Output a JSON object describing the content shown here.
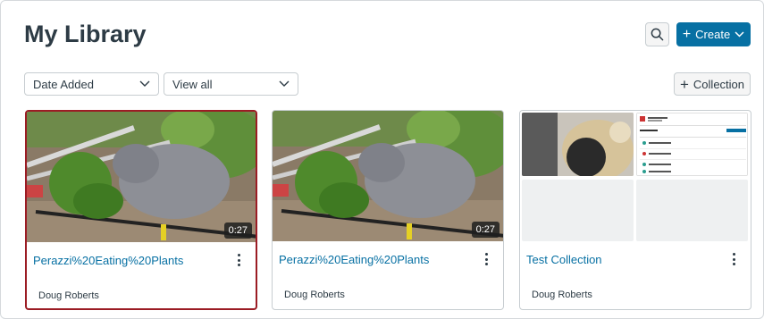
{
  "header": {
    "title": "My Library",
    "create_label": "Create"
  },
  "filters": {
    "sort_value": "Date Added",
    "view_value": "View all",
    "collection_label": "Collection"
  },
  "cards": [
    {
      "title": "Perazzi%20Eating%20Plants",
      "author": "Doug Roberts",
      "duration": "0:27",
      "selected": true
    },
    {
      "title": "Perazzi%20Eating%20Plants",
      "author": "Doug Roberts",
      "duration": "0:27",
      "selected": false
    },
    {
      "title": "Test Collection",
      "author": "Doug Roberts",
      "selected": false
    }
  ],
  "colors": {
    "accent": "#0770a3",
    "selected_border": "#9b1c24",
    "text": "#2d3b45"
  },
  "icons": [
    "search-icon",
    "plus-icon",
    "chevron-down-icon",
    "more-vertical-icon"
  ]
}
